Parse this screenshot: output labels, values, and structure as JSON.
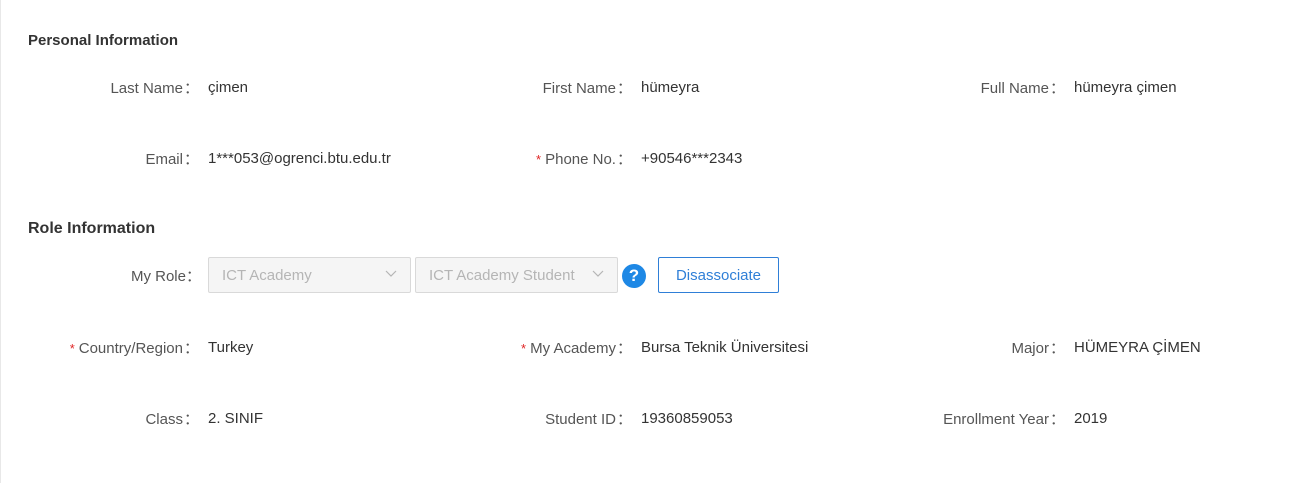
{
  "personal": {
    "title": "Personal Information",
    "last_name": {
      "label": "Last Name",
      "value": "çimen"
    },
    "first_name": {
      "label": "First Name",
      "value": "hümeyra"
    },
    "full_name": {
      "label": "Full Name",
      "value": "hümeyra çimen"
    },
    "email": {
      "label": "Email",
      "value": "1***053@ogrenci.btu.edu.tr"
    },
    "phone": {
      "label": "Phone No.",
      "value": "+90546***2343",
      "required_mark": "*"
    }
  },
  "role": {
    "title": "Role Information",
    "my_role_label": "My Role",
    "role_select_1": "ICT Academy",
    "role_select_2": "ICT Academy Student",
    "help_icon_glyph": "?",
    "disassociate_label": "Disassociate",
    "country": {
      "label": "Country/Region",
      "value": "Turkey",
      "required_mark": "*"
    },
    "academy": {
      "label": "My Academy",
      "value": "Bursa Teknik Üniversitesi",
      "required_mark": "*"
    },
    "major": {
      "label": "Major",
      "value": "HÜMEYRA ÇİMEN"
    },
    "class": {
      "label": "Class",
      "value": "2. SINIF"
    },
    "student_id": {
      "label": "Student ID",
      "value": "19360859053"
    },
    "enrollment_year": {
      "label": "Enrollment Year",
      "value": "2019"
    }
  },
  "colon": "：",
  "colors": {
    "accent": "#2f7fd7",
    "help_icon": "#1e88e5",
    "required": "#e02424",
    "disabled_text": "#b5b5b5"
  }
}
